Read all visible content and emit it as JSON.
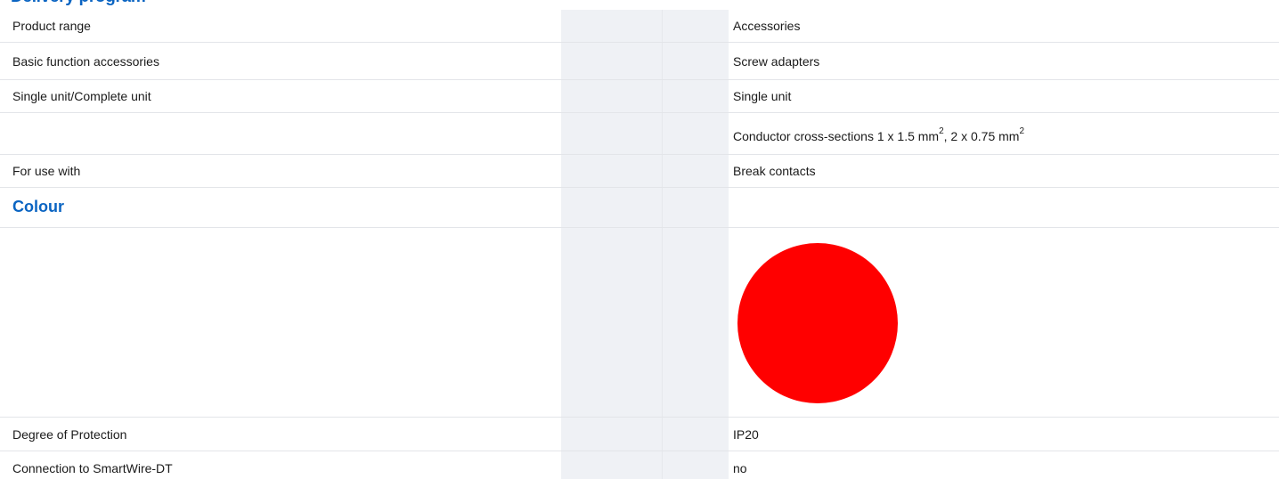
{
  "heading": "Delivery program",
  "rows": [
    {
      "label": "Product range",
      "value": "Accessories"
    },
    {
      "label": "Basic function accessories",
      "value": "Screw adapters"
    },
    {
      "label": "Single unit/Complete unit",
      "value": "Single unit"
    },
    {
      "label": "",
      "value_parts": [
        "Conductor cross-sections 1 x 1.5 mm",
        "2",
        ", 2 x 0.75 mm",
        "2"
      ]
    },
    {
      "label": "For use with",
      "value": "Break contacts"
    }
  ],
  "colour_section": {
    "title": "Colour",
    "swatch_color": "#ff0000"
  },
  "rows2": [
    {
      "label": "Degree of Protection",
      "value": "IP20"
    },
    {
      "label": "Connection to SmartWire-DT",
      "value": "no"
    }
  ]
}
